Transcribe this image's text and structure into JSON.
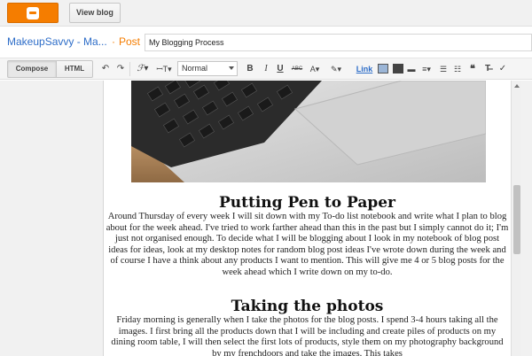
{
  "topbar": {
    "view_blog_label": "View blog"
  },
  "header": {
    "blog_name": "MakeupSavvy - Ma...",
    "separator": "·",
    "post_type": "Post",
    "post_title": "My Blogging Process"
  },
  "toolbar": {
    "compose_label": "Compose",
    "html_label": "HTML",
    "font_size_value": "Normal",
    "bold": "B",
    "italic": "I",
    "underline": "U",
    "strike": "ABC",
    "link_label": "Link"
  },
  "content": {
    "heading1": "Putting Pen to Paper",
    "paragraph1": "Around Thursday of every week I will sit down with my To-do list notebook and write what I plan to blog about for the week ahead. I've tried to work farther ahead than this in the past but I simply cannot do it; I'm just not organised enough. To decide what I will be blogging about I look in my notebook of blog post ideas for ideas, look at my desktop notes for random blog post ideas I've wrote down during the week and of course I have a think about any products I want to mention. This will give me 4 or 5 blog posts for the week ahead which I write down on my to-do.",
    "heading2": "Taking the photos",
    "paragraph2": "Friday morning is generally when I take the photos for the blog posts. I spend 3-4 hours taking all the images. I first bring all the products down that I will be including and create piles of products on my dining room table, I will then select the first lots of products, style them on my photography background by my frenchdoors and take the images. This takes"
  },
  "colors": {
    "blogger_orange": "#f57d00",
    "link_blue": "#2d6dc8"
  }
}
